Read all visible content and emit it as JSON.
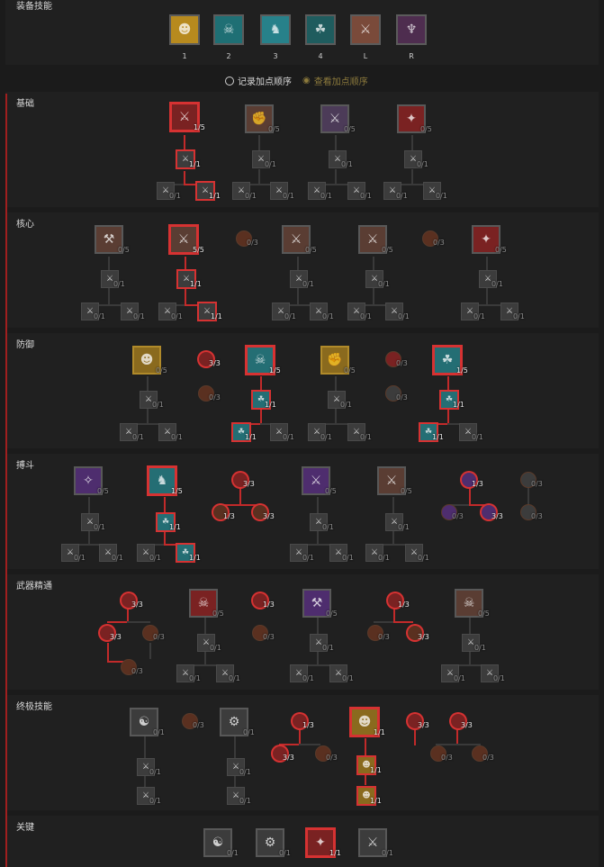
{
  "equipped": {
    "title": "装备技能",
    "slots": [
      {
        "key": "1",
        "icon": "gold-mask-icon",
        "color": "#b78a1e"
      },
      {
        "key": "2",
        "icon": "teal-demon-icon",
        "color": "#1f6f74"
      },
      {
        "key": "3",
        "icon": "teal-spirit-icon",
        "color": "#27818a"
      },
      {
        "key": "4",
        "icon": "teal-trio-icon",
        "color": "#1f5c5e"
      },
      {
        "key": "L",
        "icon": "red-sword-icon",
        "color": "#7a4a3a"
      },
      {
        "key": "R",
        "icon": "purple-chalice-icon",
        "color": "#4e2d4f"
      }
    ]
  },
  "order": {
    "record_label": "记录加点顺序",
    "view_label": "查看加点顺序"
  },
  "sections": [
    {
      "title": "基础"
    },
    {
      "title": "核心"
    },
    {
      "title": "防御"
    },
    {
      "title": "搏斗"
    },
    {
      "title": "武器精通"
    },
    {
      "title": "终极技能"
    },
    {
      "title": "关键"
    }
  ],
  "ranks": {
    "s1": [
      "1/5",
      "0/5",
      "0/5",
      "0/5",
      "1/1",
      "1/1"
    ],
    "s2": [
      "0/5",
      "5/5",
      "0/3",
      "0/5",
      "0/5",
      "0/3",
      "0/5",
      "1/1",
      "1/1"
    ],
    "s3": [
      "0/5",
      "3/3",
      "0/3",
      "1/5",
      "1/1",
      "1/1",
      "0/5",
      "0/3",
      "0/3",
      "1/5",
      "1/1",
      "1/1"
    ],
    "s4": [
      "0/5",
      "1/5",
      "1/1",
      "1/1",
      "3/3",
      "1/3",
      "3/3",
      "0/5",
      "0/5",
      "1/3",
      "0/3",
      "3/3",
      "0/3",
      "0/3"
    ],
    "s5": [
      "3/3",
      "0/5",
      "1/3",
      "0/5",
      "1/3",
      "0/5",
      "3/3",
      "0/3",
      "0/3",
      "0/3",
      "0/3",
      "3/3"
    ],
    "s6": [
      "0/1",
      "0/3",
      "0/1",
      "1/3",
      "1/1",
      "3/3",
      "3/3",
      "0/3",
      "1/1",
      "1/1",
      "0/3",
      "0/3",
      "0/1",
      "0/1",
      "0/1",
      "0/1"
    ],
    "s7": [
      "0/1",
      "0/1",
      "1/1",
      "0/1"
    ]
  },
  "colors": {
    "accent_red": "#c22a2a",
    "gold": "#b08a2a",
    "teal": "#2a7c84",
    "purple": "#5a3b7a"
  }
}
